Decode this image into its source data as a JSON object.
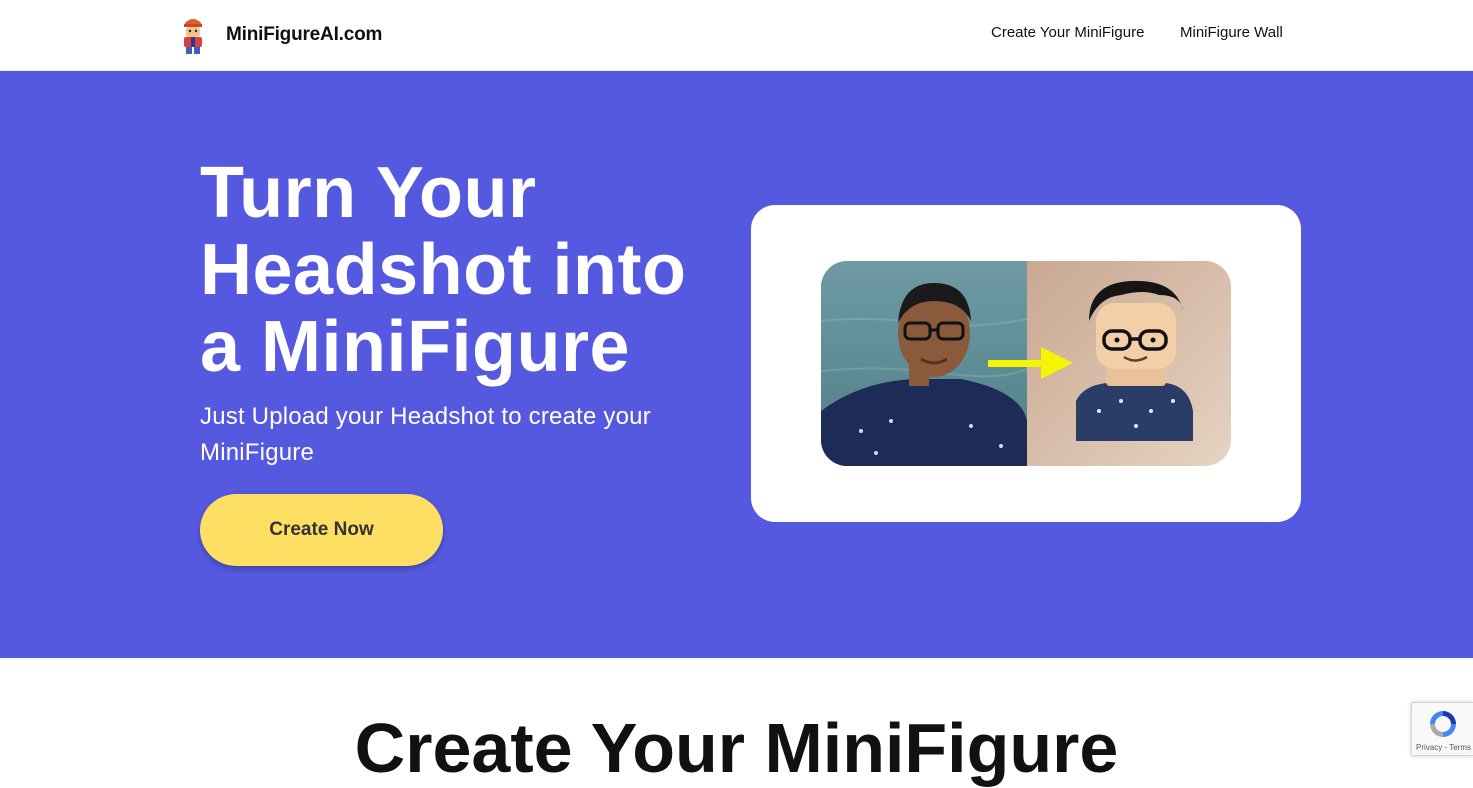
{
  "header": {
    "logo_text": "MiniFigureAI.com",
    "nav": [
      {
        "label": "Create Your MiniFigure"
      },
      {
        "label": "MiniFigure Wall"
      }
    ]
  },
  "hero": {
    "title": "Turn Your Headshot into a MiniFigure",
    "subtitle": "Just Upload your Headshot to create your MiniFigure",
    "cta_label": "Create Now",
    "background_color": "#5559df",
    "cta_color": "#fddf63",
    "image": {
      "left": "headshot-photo",
      "arrow": "arrow-right-icon",
      "right": "minifigure-render",
      "arrow_color": "#f5f500"
    }
  },
  "section": {
    "title": "Create Your MiniFigure"
  },
  "recaptcha": {
    "privacy": "Privacy",
    "separator": " - ",
    "terms": "Terms"
  }
}
